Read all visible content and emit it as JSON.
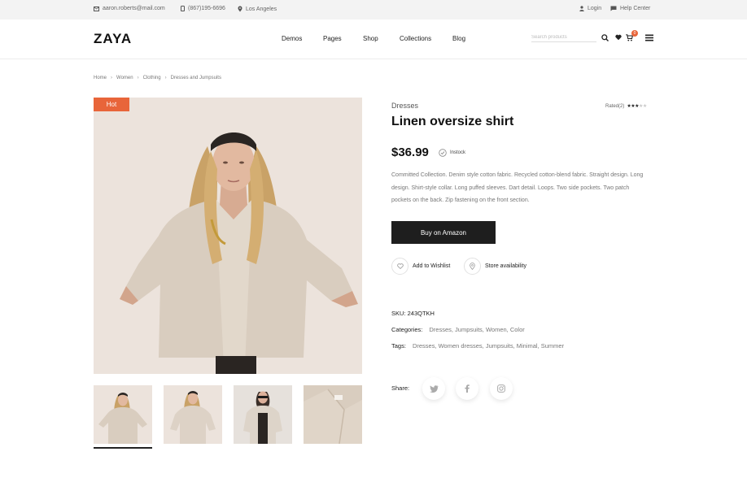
{
  "topbar": {
    "email": "aaron.roberts@mail.com",
    "phone": "(867)195-6696",
    "location": "Los Angeles",
    "login": "Login",
    "help": "Help Center"
  },
  "header": {
    "logo": "ZAYA",
    "nav": [
      "Demos",
      "Pages",
      "Shop",
      "Collections",
      "Blog"
    ],
    "search_placeholder": "Search products",
    "cart_count": "0"
  },
  "breadcrumb": [
    "Home",
    "Women",
    "Clothing",
    "Dresses and Jumpsuits"
  ],
  "gallery": {
    "badge": "Hot",
    "thumbnails": 4,
    "active_thumbnail": 0
  },
  "product": {
    "category": "Dresses",
    "rating_label": "Rated(2)",
    "rating": 3,
    "rating_max": 5,
    "title": "Linen oversize shirt",
    "price": "$36.99",
    "stock": "Instock",
    "description": "Committed Collection. Denim style cotton fabric. Recycled cotton-blend fabric. Straight design. Long design. Shirt-style collar. Long puffed sleeves. Dart detail. Loops. Two side pockets. Two patch pockets on the back. Zip fastening on the front section.",
    "buy_label": "Buy on Amazon",
    "wishlist_label": "Add to Wishlist",
    "store_label": "Store availability",
    "sku_label": "SKU:",
    "sku": "243QTKH",
    "categories_label": "Categories:",
    "categories": "Dresses, Jumpsuits, Women, Color",
    "tags_label": "Tags:",
    "tags": "Dresses, Women dresses, Jumpsuits, Minimal, Summer",
    "share_label": "Share:",
    "share_icons": [
      "twitter-icon",
      "facebook-icon",
      "instagram-icon"
    ]
  },
  "colors": {
    "accent": "#e8653a",
    "button": "#1e1e1e",
    "image_bg": "#ece3dc",
    "shirt": "#d9cdbf",
    "hair": "#c9a267"
  }
}
